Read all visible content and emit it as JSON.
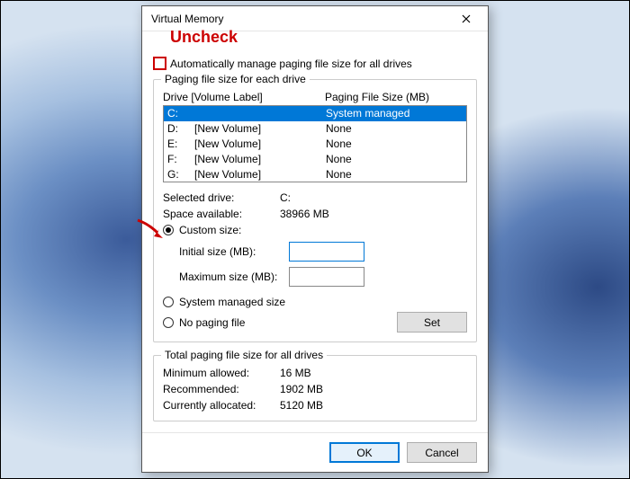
{
  "window": {
    "title": "Virtual Memory"
  },
  "annotations": {
    "uncheck_label": "Uncheck"
  },
  "auto_manage": {
    "label": "Automatically manage paging file size for all drives",
    "checked": false
  },
  "per_drive": {
    "group_title": "Paging file size for each drive",
    "header_drive": "Drive  [Volume Label]",
    "header_size": "Paging File Size (MB)",
    "rows": [
      {
        "letter": "C:",
        "label": "",
        "size": "System managed",
        "selected": true
      },
      {
        "letter": "D:",
        "label": "[New Volume]",
        "size": "None",
        "selected": false
      },
      {
        "letter": "E:",
        "label": "[New Volume]",
        "size": "None",
        "selected": false
      },
      {
        "letter": "F:",
        "label": "[New Volume]",
        "size": "None",
        "selected": false
      },
      {
        "letter": "G:",
        "label": "[New Volume]",
        "size": "None",
        "selected": false
      }
    ],
    "selected_drive_label": "Selected drive:",
    "selected_drive_value": "C:",
    "space_available_label": "Space available:",
    "space_available_value": "38966 MB",
    "custom_size_label": "Custom size:",
    "initial_size_label": "Initial size (MB):",
    "initial_size_value": "",
    "maximum_size_label": "Maximum size (MB):",
    "maximum_size_value": "",
    "system_managed_label": "System managed size",
    "no_paging_label": "No paging file",
    "set_button": "Set",
    "radio_selected": "custom"
  },
  "totals": {
    "group_title": "Total paging file size for all drives",
    "min_label": "Minimum allowed:",
    "min_value": "16 MB",
    "rec_label": "Recommended:",
    "rec_value": "1902 MB",
    "cur_label": "Currently allocated:",
    "cur_value": "5120 MB"
  },
  "buttons": {
    "ok": "OK",
    "cancel": "Cancel"
  }
}
